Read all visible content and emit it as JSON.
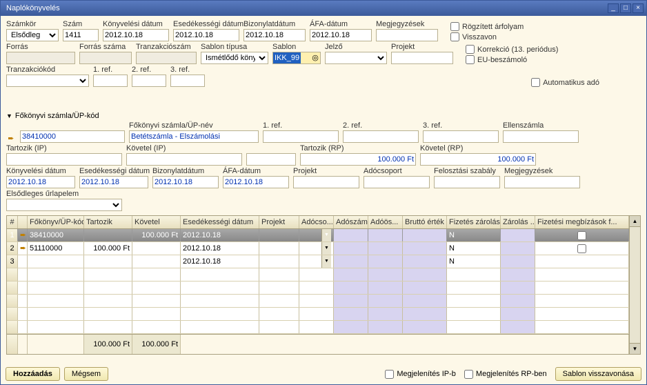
{
  "window": {
    "title": "Naplókönyvelés"
  },
  "header": {
    "labels": {
      "szamkor": "Számkör",
      "szam": "Szám",
      "konyvdat": "Könyvelési dátum",
      "esdat": "Esedékességi dátum",
      "bizdat": "Bizonylatdátum",
      "afadat": "ÁFA-dátum",
      "megj": "Megjegyzések",
      "forras": "Forrás",
      "forrasszam": "Forrás száma",
      "transzszam": "Tranzakciószám",
      "sablontipus": "Sablon típusa",
      "sablon": "Sablon",
      "jelzo": "Jelző",
      "projekt": "Projekt",
      "transzkod": "Tranzakciókód",
      "ref1": "1. ref.",
      "ref2": "2. ref.",
      "ref3": "3. ref."
    },
    "values": {
      "szamkor": "Elsődleg",
      "szam": "1411",
      "konyvdat": "2012.10.18",
      "esdat": "2012.10.18",
      "bizdat": "2012.10.18",
      "afadat": "2012.10.18",
      "sablontipus": "Ismétlődő könyv.",
      "sablon": "IKK_99"
    },
    "checks": {
      "rogzitett": "Rögzített árfolyam",
      "visszavon": "Visszavon",
      "korrekcio": "Korrekció (13. periódus)",
      "eu": "EU-beszámoló",
      "autoado": "Automatikus adó"
    }
  },
  "detail": {
    "section": "Főkönyvi számla/ÜP-kód",
    "labels": {
      "fokonyvnev": "Főkönyvi számla/ÜP-név",
      "ref1": "1. ref.",
      "ref2": "2. ref.",
      "ref3": "3. ref.",
      "ellenszamla": "Ellenszámla",
      "tartozikip": "Tartozik (IP)",
      "kovetelip": "Követel (IP)",
      "tartozikrp": "Tartozik (RP)",
      "kovetelrp": "Követel (RP)",
      "konyvdat": "Könyvelési dátum",
      "esdat": "Esedékességi dátum",
      "bizdat": "Bizonylatdátum",
      "afadat": "ÁFA-dátum",
      "projekt": "Projekt",
      "adocsoport": "Adócsoport",
      "felosztas": "Felosztási szabály",
      "megj": "Megjegyzések",
      "urlapelem": "Elsődleges űrlapelem"
    },
    "values": {
      "fokod": "38410000",
      "fokonyvnev": "Betétszámla - Elszámolási",
      "tartozikrp": "100.000 Ft",
      "kovetelrp": "100.000 Ft",
      "konyvdat": "2012.10.18",
      "esdat": "2012.10.18",
      "bizdat": "2012.10.18",
      "afadat": "2012.10.18"
    }
  },
  "grid": {
    "headers": {
      "idx": "#",
      "fok": "Főkönyv/ÜP-kód",
      "tar": "Tartozik",
      "kov": "Követel",
      "esd": "Esedékességi dátum",
      "prj": "Projekt",
      "acs": "Adócso...",
      "asz": "Adószám",
      "aos": "Adóös...",
      "bru": "Bruttó érték",
      "fz": "Fizetés zárolása",
      "zar": "Zárolás ...",
      "fm": "Fizetési megbízások f..."
    },
    "rows": [
      {
        "idx": "1",
        "fok": "38410000",
        "tar": "",
        "kov": "100.000 Ft",
        "esd": "2012.10.18",
        "fz": "N",
        "active": true
      },
      {
        "idx": "2",
        "fok": "51110000",
        "tar": "100.000 Ft",
        "kov": "",
        "esd": "2012.10.18",
        "fz": "N",
        "active": false
      },
      {
        "idx": "3",
        "fok": "",
        "tar": "",
        "kov": "",
        "esd": "2012.10.18",
        "fz": "N",
        "active": false
      }
    ],
    "totals": {
      "tar": "100.000 Ft",
      "kov": "100.000 Ft"
    }
  },
  "footer": {
    "add": "Hozzáadás",
    "cancel": "Mégsem",
    "chk_ip": "Megjelenítés IP-b",
    "chk_rp": "Megjelenítés RP-ben",
    "template_cancel": "Sablon visszavonása"
  }
}
